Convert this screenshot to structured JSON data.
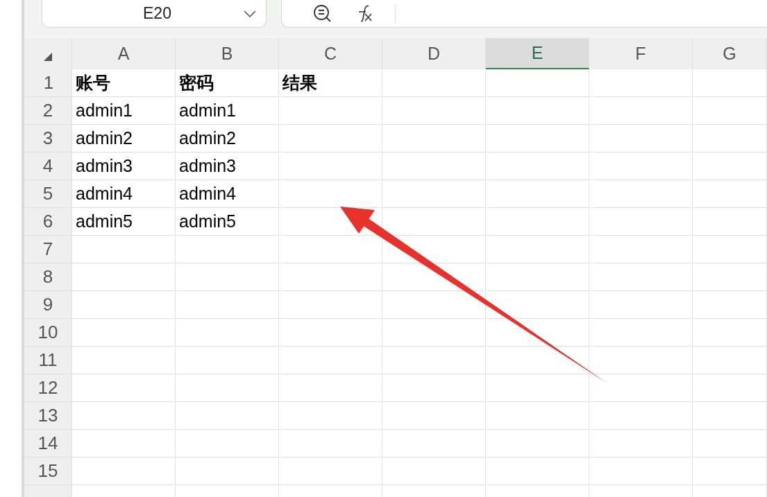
{
  "name_box": {
    "value": "E20"
  },
  "columns": [
    {
      "label": "A",
      "selected": false
    },
    {
      "label": "B",
      "selected": false
    },
    {
      "label": "C",
      "selected": false
    },
    {
      "label": "D",
      "selected": false
    },
    {
      "label": "E",
      "selected": true
    },
    {
      "label": "F",
      "selected": false
    },
    {
      "label": "G",
      "selected": false
    }
  ],
  "rows": [
    {
      "label": "1",
      "bold": true,
      "cells": [
        "账号",
        "密码",
        "结果"
      ]
    },
    {
      "label": "2",
      "bold": false,
      "cells": [
        "admin1",
        "admin1"
      ]
    },
    {
      "label": "3",
      "bold": false,
      "cells": [
        "admin2",
        "admin2"
      ]
    },
    {
      "label": "4",
      "bold": false,
      "cells": [
        "admin3",
        "admin3"
      ]
    },
    {
      "label": "5",
      "bold": false,
      "cells": [
        "admin4",
        "admin4"
      ]
    },
    {
      "label": "6",
      "bold": false,
      "cells": [
        "admin5",
        "admin5"
      ]
    },
    {
      "label": "7",
      "bold": false,
      "cells": []
    },
    {
      "label": "8",
      "bold": false,
      "cells": []
    },
    {
      "label": "9",
      "bold": false,
      "cells": []
    },
    {
      "label": "10",
      "bold": false,
      "cells": []
    },
    {
      "label": "11",
      "bold": false,
      "cells": []
    },
    {
      "label": "12",
      "bold": false,
      "cells": []
    },
    {
      "label": "13",
      "bold": false,
      "cells": []
    },
    {
      "label": "14",
      "bold": false,
      "cells": []
    },
    {
      "label": "15",
      "bold": false,
      "cells": []
    }
  ]
}
